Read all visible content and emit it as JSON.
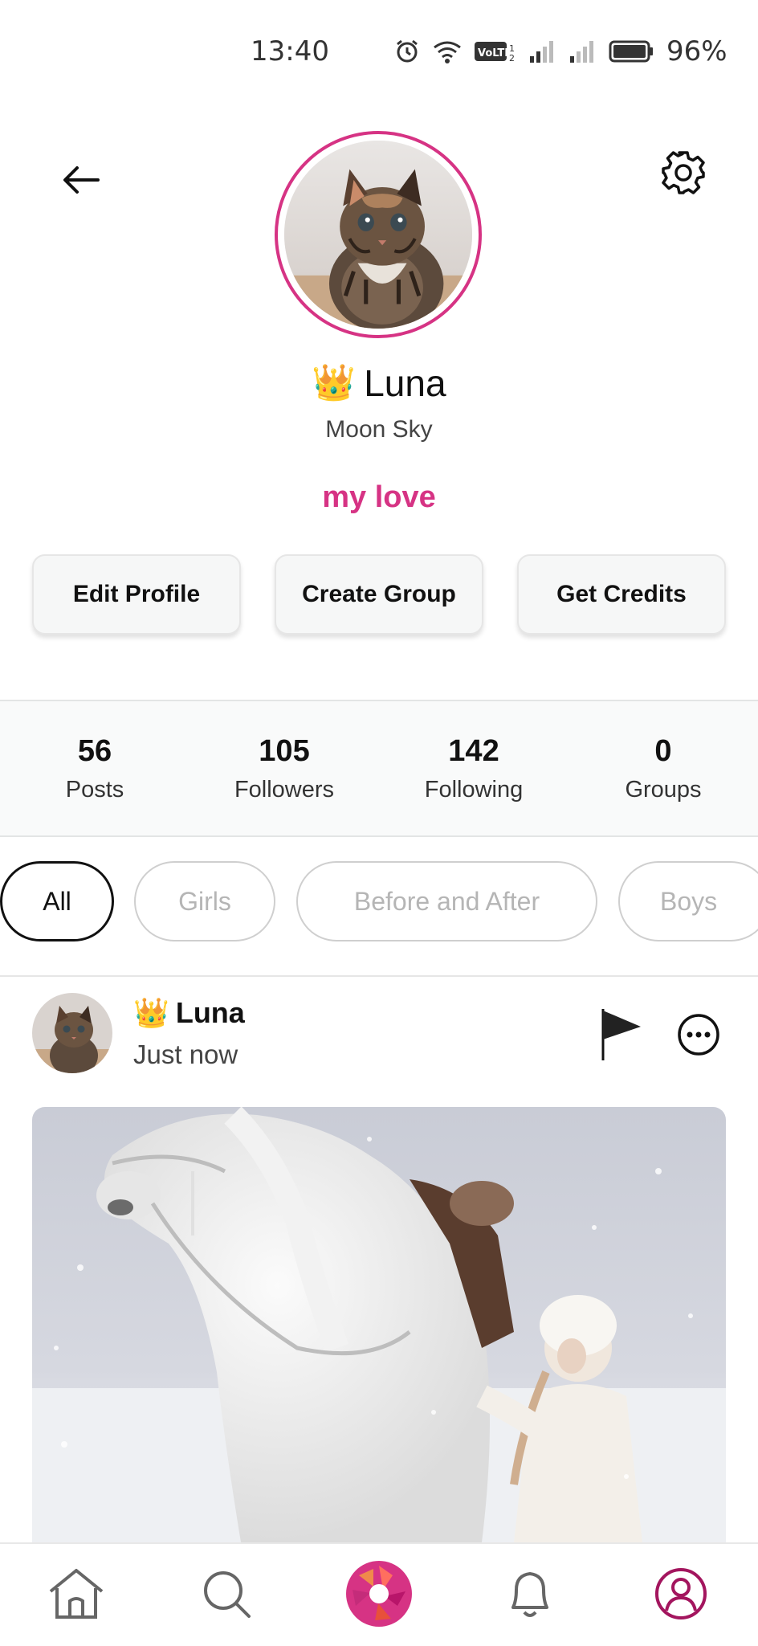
{
  "status_bar": {
    "time": "13:40",
    "battery_percent": "96%",
    "icons": [
      "alarm-icon",
      "wifi-icon",
      "volte-icon",
      "signal-icon",
      "signal-roaming-icon",
      "battery-icon"
    ]
  },
  "header": {
    "back_icon": "arrow-left-icon",
    "settings_icon": "gear-icon"
  },
  "profile": {
    "crown": "👑",
    "name": "Luna",
    "handle": "Moon Sky",
    "bio": "my love",
    "ring_color": "#d63384"
  },
  "actions": {
    "edit_profile": "Edit Profile",
    "create_group": "Create Group",
    "get_credits": "Get Credits"
  },
  "stats": [
    {
      "count": "56",
      "label": "Posts"
    },
    {
      "count": "105",
      "label": "Followers"
    },
    {
      "count": "142",
      "label": "Following"
    },
    {
      "count": "0",
      "label": "Groups"
    }
  ],
  "filters": [
    {
      "label": "All",
      "active": true
    },
    {
      "label": "Girls",
      "active": false
    },
    {
      "label": "Before and After",
      "active": false
    },
    {
      "label": "Boys",
      "active": false
    }
  ],
  "post": {
    "crown": "👑",
    "author": "Luna",
    "time": "Just now"
  },
  "bottom_nav": {
    "items": [
      "home-icon",
      "search-icon",
      "camera-shutter-icon",
      "bell-icon",
      "profile-icon"
    ],
    "active": "profile-icon"
  },
  "colors": {
    "accent": "#d63384"
  }
}
